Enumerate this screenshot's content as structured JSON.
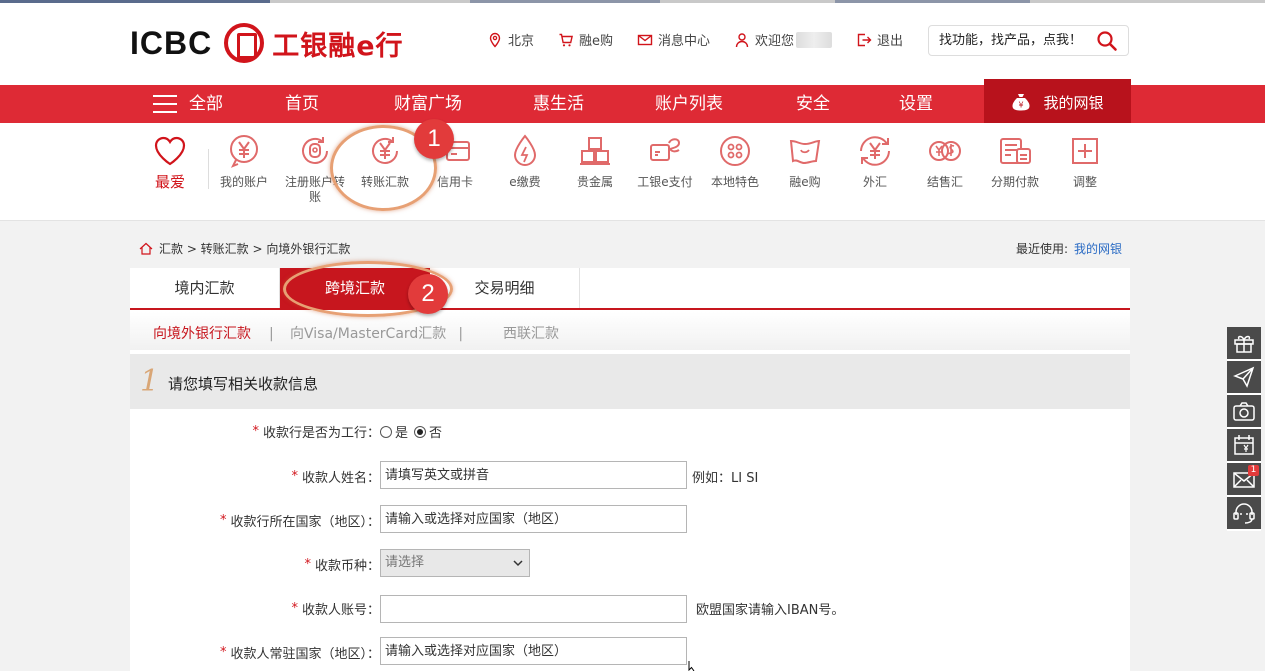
{
  "header": {
    "logo_text": "ICBC",
    "brand_text": "工银融e行",
    "links": [
      {
        "label": "北京",
        "icon": "location-pin-icon"
      },
      {
        "label": "融e购",
        "icon": "cart-icon"
      },
      {
        "label": "消息中心",
        "icon": "mail-icon"
      },
      {
        "label": "欢迎您",
        "icon": "user-icon"
      },
      {
        "label": "退出",
        "icon": "logout-icon"
      }
    ],
    "search_placeholder": "找功能，找产品，点我！"
  },
  "nav": {
    "menu_label": "全部",
    "items": [
      "首页",
      "财富广场",
      "惠生活",
      "账户列表",
      "安全",
      "设置"
    ],
    "my_bank": "我的网银"
  },
  "iconbar": {
    "favorite": "最爱",
    "items": [
      {
        "label": "我的账户",
        "icon": "yen-coin-icon"
      },
      {
        "label": "注册账户转账",
        "icon": "registered-transfer-icon"
      },
      {
        "label": "转账汇款",
        "icon": "transfer-yen-icon"
      },
      {
        "label": "信用卡",
        "icon": "credit-card-icon"
      },
      {
        "label": "e缴费",
        "icon": "water-drop-icon"
      },
      {
        "label": "贵金属",
        "icon": "gold-bars-icon"
      },
      {
        "label": "工银e支付",
        "icon": "e-pay-icon"
      },
      {
        "label": "本地特色",
        "icon": "local-feature-icon"
      },
      {
        "label": "融e购",
        "icon": "shopping-flag-icon"
      },
      {
        "label": "外汇",
        "icon": "forex-icon"
      },
      {
        "label": "结售汇",
        "icon": "exchange-icon"
      },
      {
        "label": "分期付款",
        "icon": "installment-icon"
      },
      {
        "label": "调整",
        "icon": "plus-square-icon"
      }
    ],
    "annotations": [
      "1",
      "2"
    ]
  },
  "breadcrumb": {
    "items": [
      "汇款",
      ">",
      "转账汇款",
      ">",
      "向境外银行汇款"
    ],
    "text": "汇款 > 转账汇款 > 向境外银行汇款",
    "recent_label": "最近使用:",
    "recent_link": "我的网银"
  },
  "tabs": [
    "境内汇款",
    "跨境汇款",
    "交易明细"
  ],
  "subtabs": [
    "向境外银行汇款",
    "向Visa/MasterCard汇款",
    "西联汇款"
  ],
  "section": {
    "number": "1",
    "title": "请您填写相关收款信息"
  },
  "form": {
    "is_icbc": {
      "label": "收款行是否为工行：",
      "options": [
        "是",
        "否"
      ],
      "selected": "否"
    },
    "payee_name": {
      "label": "收款人姓名：",
      "placeholder": "请填写英文或拼音",
      "hint": "例如：LI SI"
    },
    "bank_country": {
      "label": "收款行所在国家（地区）：",
      "placeholder": "请输入或选择对应国家（地区）"
    },
    "currency": {
      "label": "收款币种：",
      "value": "请选择"
    },
    "account": {
      "label": "收款人账号：",
      "value": "",
      "hint": "欧盟国家请输入IBAN号。"
    },
    "resident_country": {
      "label": "收款人常驻国家（地区）：",
      "placeholder": "请输入或选择对应国家（地区）"
    }
  },
  "float_bar": [
    {
      "icon": "gift-icon"
    },
    {
      "icon": "paper-plane-icon"
    },
    {
      "icon": "camera-icon"
    },
    {
      "icon": "calendar-yen-icon"
    },
    {
      "icon": "envelope-icon",
      "count": "1"
    },
    {
      "icon": "customer-service-icon"
    }
  ],
  "colors": {
    "brand_red": "#de2a35",
    "dark_red": "#c7161e",
    "annotation_red": "#e23b3b",
    "link_blue": "#2a6bc4"
  }
}
